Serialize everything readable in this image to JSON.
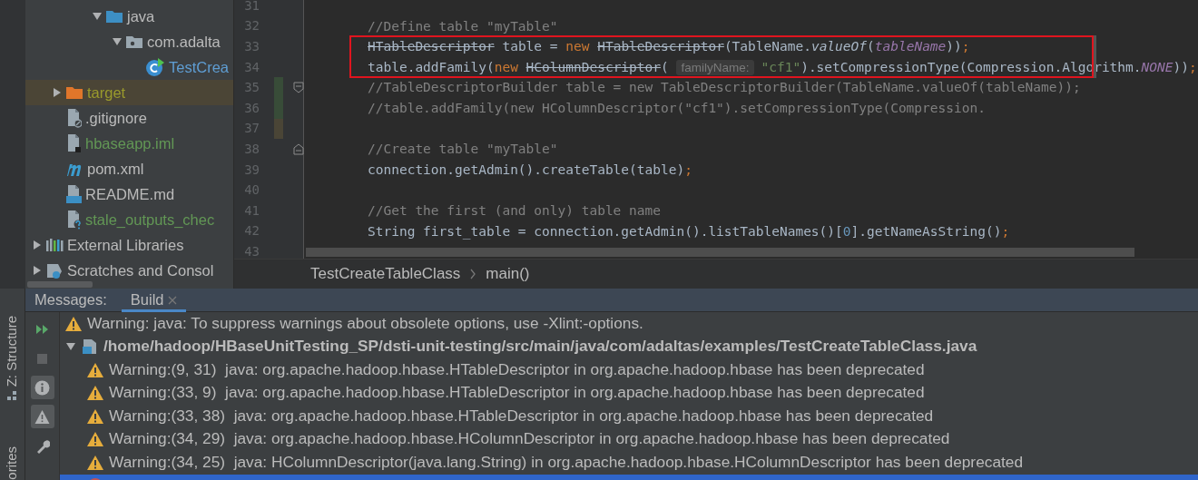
{
  "project_tree": [
    {
      "children": [
        {
          "children": [
            {
              "children": [
                {
                  "label": "java",
                  "kind": "folder",
                  "expanded": true,
                  "highlighted": false,
                  "color": "#bbbbbb",
                  "children": [
                    {
                      "label": "com.adalta",
                      "kind": "package",
                      "expanded": true,
                      "highlighted": false,
                      "color": "#bbbbbb",
                      "children": [
                        {
                          "label": "TestCrea",
                          "kind": "class",
                          "highlighted": false,
                          "color": "#5f9ed4"
                        }
                      ]
                    }
                  ]
                }
              ]
            }
          ]
        },
        {
          "label": "target",
          "kind": "excluded-folder",
          "expanded": false,
          "highlighted": true,
          "color": "#9a9a2c"
        },
        {
          "label": ".gitignore",
          "kind": "ignore-file",
          "highlighted": false,
          "color": "#bbbbbb"
        },
        {
          "label": "hbaseapp.iml",
          "kind": "module-file",
          "highlighted": false,
          "color": "#629755"
        },
        {
          "label": "pom.xml",
          "kind": "maven-file",
          "highlighted": false,
          "color": "#bbbbbb"
        },
        {
          "label": "README.md",
          "kind": "markdown-file",
          "highlighted": false,
          "color": "#bbbbbb"
        },
        {
          "label": "stale_outputs_chec",
          "kind": "unknown-file",
          "highlighted": false,
          "color": "#629755"
        }
      ]
    },
    {
      "label": "External Libraries",
      "kind": "library",
      "expanded": false,
      "highlighted": false,
      "color": "#bbbbbb"
    },
    {
      "label": "Scratches and Consol",
      "kind": "scratch",
      "expanded": false,
      "highlighted": false,
      "color": "#bbbbbb"
    }
  ],
  "editor": {
    "lines": [
      {
        "number": "31"
      },
      {
        "number": "32",
        "tokens": [
          {
            "kind": "comment",
            "text": "//Define table \"myTable\""
          }
        ]
      },
      {
        "number": "33",
        "boxed": true,
        "tokens": [
          {
            "kind": "deprecated",
            "text": "HTableDescriptor"
          },
          {
            "kind": "plain",
            "text": " table = "
          },
          {
            "kind": "keyword",
            "text": "new "
          },
          {
            "kind": "deprecated",
            "text": "HTableDescriptor"
          },
          {
            "kind": "plain",
            "text": "(TableName."
          },
          {
            "kind": "static",
            "text": "valueOf"
          },
          {
            "kind": "plain",
            "text": "("
          },
          {
            "kind": "param",
            "text": "tableName"
          },
          {
            "kind": "plain",
            "text": "))"
          },
          {
            "kind": "keyword",
            "text": ";"
          }
        ]
      },
      {
        "number": "34",
        "boxed": true,
        "tokens": [
          {
            "kind": "plain",
            "text": "table.addFamily("
          },
          {
            "kind": "keyword",
            "text": "new "
          },
          {
            "kind": "deprecated",
            "text": "HColumnDescriptor"
          },
          {
            "kind": "plain",
            "text": "( "
          },
          {
            "kind": "hint",
            "text": "familyName:"
          },
          {
            "kind": "string",
            "text": "\"cf1\""
          },
          {
            "kind": "plain",
            "text": ").setCompressionType(Compression.Algorithm."
          },
          {
            "kind": "param",
            "text": "NONE"
          },
          {
            "kind": "plain",
            "text": "))"
          },
          {
            "kind": "keyword",
            "text": ";"
          }
        ]
      },
      {
        "number": "35",
        "color": "#384c38",
        "fold_start": true,
        "tokens": [
          {
            "kind": "comment",
            "text": "//TableDescriptorBuilder table = new TableDescriptorBuilder(TableName.valueOf(tableName));"
          }
        ]
      },
      {
        "number": "36",
        "color": "#384c38",
        "tokens": [
          {
            "kind": "comment",
            "text": "//table.addFamily(new HColumnDescriptor(\"cf1\").setCompressionType(Compression."
          }
        ]
      },
      {
        "number": "37",
        "color": "#4a4536"
      },
      {
        "number": "38",
        "fold_end": true,
        "tokens": [
          {
            "kind": "comment",
            "text": "//Create table \"myTable\""
          }
        ]
      },
      {
        "number": "39",
        "tokens": [
          {
            "kind": "plain",
            "text": "connection.getAdmin().createTable(table)"
          },
          {
            "kind": "keyword",
            "text": ";"
          }
        ]
      },
      {
        "number": "40"
      },
      {
        "number": "41",
        "tokens": [
          {
            "kind": "comment",
            "text": "//Get the first (and only) table name"
          }
        ]
      },
      {
        "number": "42",
        "tokens": [
          {
            "kind": "plain",
            "text": "String first_table = connection.getAdmin().listTableNames()["
          },
          {
            "kind": "number",
            "text": "0"
          },
          {
            "kind": "plain",
            "text": "].getNameAsString()"
          },
          {
            "kind": "keyword",
            "text": ";"
          }
        ]
      },
      {
        "number": "43"
      }
    ],
    "breadcrumbs": [
      "TestCreateTableClass",
      "main()"
    ]
  },
  "side_tabs": [
    {
      "label": "Z: Structure"
    },
    {
      "label": "orites"
    }
  ],
  "bottom_panel": {
    "title": "Messages:",
    "tabs": [
      {
        "label": "Build",
        "selected": true
      }
    ],
    "tools": [
      {
        "kind": "rerun",
        "on": false
      },
      {
        "kind": "stop",
        "on": false
      },
      {
        "kind": "info",
        "on": true
      },
      {
        "kind": "warning",
        "on": true
      },
      {
        "kind": "settings",
        "on": false
      }
    ],
    "messages": [
      {
        "kind": "warning",
        "selected": false,
        "text": "Warning: java: To suppress warnings about obsolete options, use -Xlint:-options."
      },
      {
        "kind": "file",
        "selected": false,
        "expanded": true,
        "text": "/home/hadoop/HBaseUnitTesting_SP/dsti-unit-testing/src/main/java/com/adaltas/examples/TestCreateTableClass.java",
        "children": [
          {
            "kind": "warning",
            "selected": false,
            "text": "Warning:(9, 31)  java: org.apache.hadoop.hbase.HTableDescriptor in org.apache.hadoop.hbase has been deprecated"
          },
          {
            "kind": "warning",
            "selected": false,
            "text": "Warning:(33, 9)  java: org.apache.hadoop.hbase.HTableDescriptor in org.apache.hadoop.hbase has been deprecated"
          },
          {
            "kind": "warning",
            "selected": false,
            "text": "Warning:(33, 38)  java: org.apache.hadoop.hbase.HTableDescriptor in org.apache.hadoop.hbase has been deprecated"
          },
          {
            "kind": "warning",
            "selected": false,
            "text": "Warning:(34, 29)  java: org.apache.hadoop.hbase.HColumnDescriptor in org.apache.hadoop.hbase has been deprecated"
          },
          {
            "kind": "warning",
            "selected": false,
            "text": "Warning:(34, 25)  java: HColumnDescriptor(java.lang.String) in org.apache.hadoop.hbase.HColumnDescriptor has been deprecated"
          },
          {
            "kind": "error",
            "selected": true
          }
        ]
      }
    ]
  }
}
